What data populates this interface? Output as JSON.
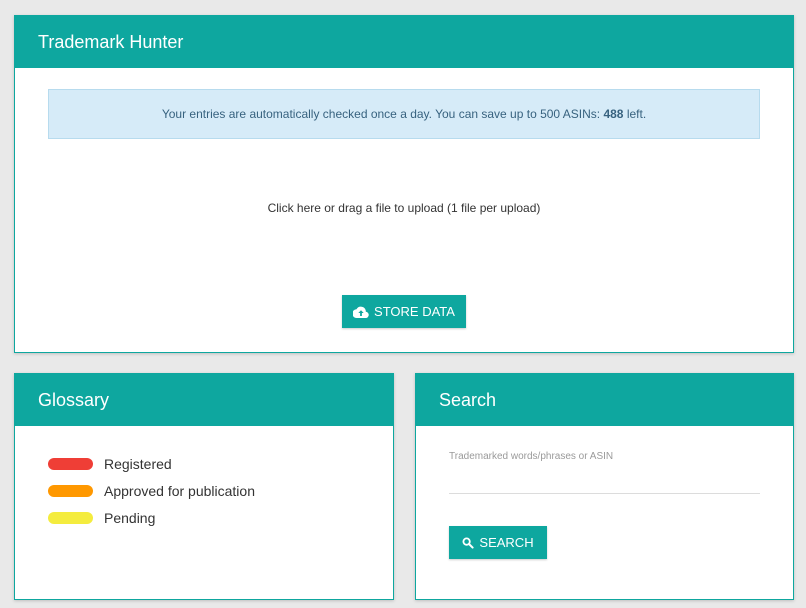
{
  "main": {
    "title": "Trademark Hunter",
    "info_prefix": "Your entries are automatically checked once a day. You can save up to 500 ASINs: ",
    "info_count": "488",
    "info_suffix": " left.",
    "upload_text": "Click here or drag a file to upload (1 file per upload)",
    "store_label": "STORE DATA",
    "store_icon": "cloud-upload-icon"
  },
  "glossary": {
    "title": "Glossary",
    "items": [
      {
        "label": "Registered",
        "color": "#ef3e36"
      },
      {
        "label": "Approved for publication",
        "color": "#ff9800"
      },
      {
        "label": "Pending",
        "color": "#f4ec3e"
      }
    ]
  },
  "search": {
    "title": "Search",
    "field_label": "Trademarked words/phrases or ASIN",
    "field_value": "",
    "button_label": "SEARCH",
    "button_icon": "search-icon"
  },
  "colors": {
    "accent": "#0ea79f",
    "info_bg": "#d6ebf8",
    "info_text": "#37627f"
  }
}
